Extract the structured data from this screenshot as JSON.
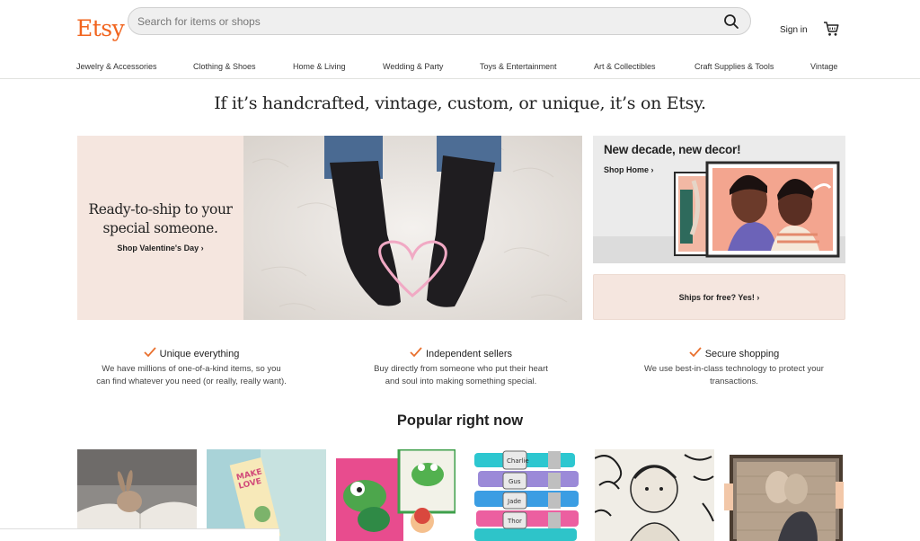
{
  "header": {
    "logo": "Etsy",
    "search_placeholder": "Search for items or shops",
    "sign_in": "Sign in"
  },
  "nav": [
    "Jewelry & Accessories",
    "Clothing & Shoes",
    "Home & Living",
    "Wedding & Party",
    "Toys & Entertainment",
    "Art & Collectibles",
    "Craft Supplies & Tools",
    "Vintage"
  ],
  "tagline": "If it’s handcrafted, vintage, custom, or unique, it’s on Etsy.",
  "hero": {
    "title_line1": "Ready-to-ship to your",
    "title_line2": "special someone.",
    "link": "Shop Valentine's Day ›"
  },
  "decor_card": {
    "title": "New decade, new decor!",
    "link": "Shop Home ›"
  },
  "ships_card": {
    "label": "Ships for free? Yes! ›"
  },
  "features": [
    {
      "title": "Unique everything",
      "desc_line1": "We have millions of one-of-a-kind items, so you",
      "desc_line2": "can find whatever you need (or really, really want)."
    },
    {
      "title": "Independent sellers",
      "desc_line1": "Buy directly from someone who put their heart",
      "desc_line2": "and soul into making something special."
    },
    {
      "title": "Secure shopping",
      "desc_line1": "We use best-in-class technology to protect your",
      "desc_line2": "transactions."
    }
  ],
  "popular_title": "Popular right now",
  "colors": {
    "brand": "#f1641e",
    "hero_bg": "#f5e6df",
    "check": "#e9702e"
  },
  "icons": [
    "search-icon",
    "cart-icon",
    "chevron-right-icon",
    "check-icon"
  ],
  "collar_names": [
    "Charlie",
    "Gus",
    "Jade",
    "Thor"
  ]
}
